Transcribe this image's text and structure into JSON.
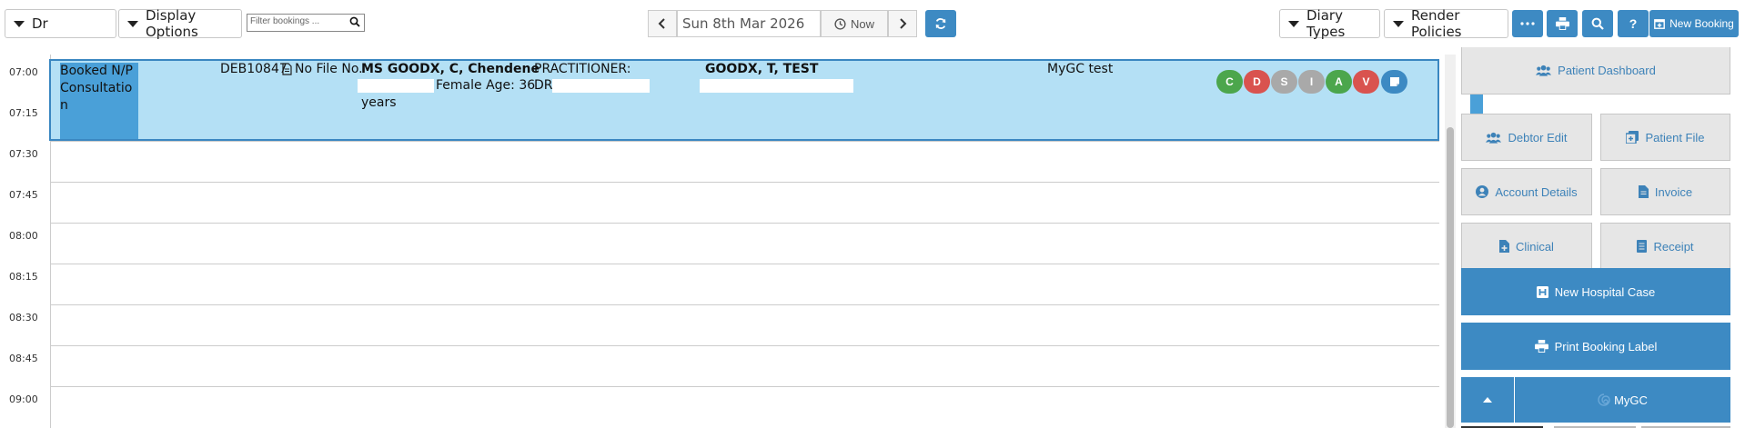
{
  "toolbar": {
    "diary_select": "Dr",
    "display_options": "Display Options",
    "filter_placeholder": "Filter bookings ...",
    "date": "Sun 8th Mar 2026",
    "now_label": "Now",
    "diary_types": "Diary Types",
    "render_policies": "Render Policies",
    "new_booking": "New Booking"
  },
  "times": [
    "07:00",
    "07:15",
    "07:30",
    "07:45",
    "08:00",
    "08:15",
    "08:30",
    "08:45",
    "09:00"
  ],
  "booking": {
    "status": "Booked N/P Consultation",
    "debtor": "DEB10847",
    "file": "No File No.",
    "patient": "MS GOODX, C, Chendene",
    "gender_age": "Female Age: 36",
    "years": "years",
    "practitioner_label": "PRACTITIONER:",
    "practitioner_dr": "DR",
    "doctor": "GOODX, T, TEST",
    "note": "MyGC test",
    "badges": [
      {
        "letter": "C",
        "color": "#4ca64c"
      },
      {
        "letter": "D",
        "color": "#d9534f"
      },
      {
        "letter": "S",
        "color": "#a9a9a9"
      },
      {
        "letter": "I",
        "color": "#a9a9a9"
      },
      {
        "letter": "A",
        "color": "#4ca64c"
      },
      {
        "letter": "V",
        "color": "#d9534f"
      }
    ]
  },
  "side": {
    "patient_dashboard": "Patient Dashboard",
    "debtor_edit": "Debtor Edit",
    "patient_file": "Patient File",
    "account_details": "Account Details",
    "invoice": "Invoice",
    "clinical": "Clinical",
    "receipt": "Receipt",
    "new_hospital_case": "New Hospital Case",
    "print_booking_label": "Print Booking Label",
    "mygc": "MyGC"
  }
}
